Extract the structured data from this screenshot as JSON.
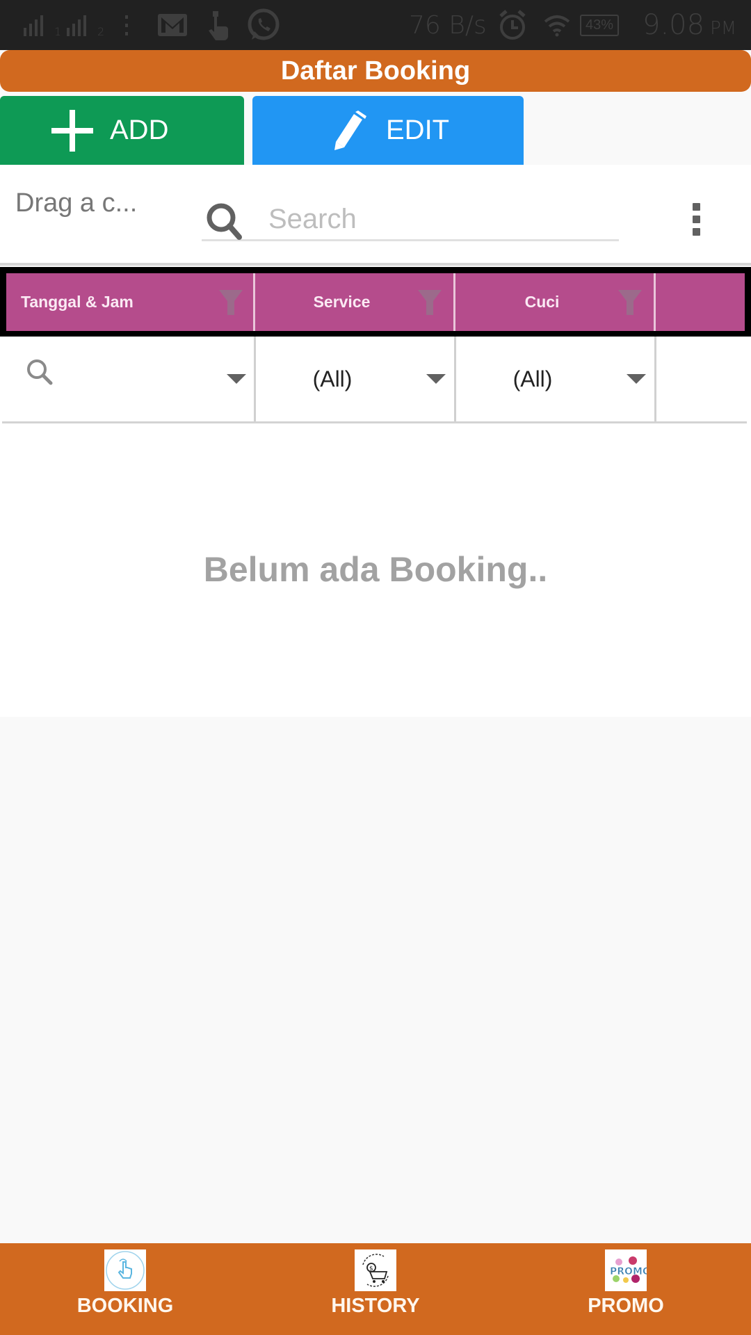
{
  "status_bar": {
    "signal1": "1",
    "signal2": "2",
    "net_speed": "76 B/s",
    "battery": "43%",
    "time": "9.08",
    "ampm": "PM"
  },
  "header": {
    "title": "Daftar Booking"
  },
  "actions": {
    "add_label": "ADD",
    "edit_label": "EDIT"
  },
  "toolbar": {
    "drag_hint": "Drag a c...",
    "search_placeholder": "Search",
    "search_value": ""
  },
  "grid": {
    "columns": [
      {
        "label": "Tanggal & Jam"
      },
      {
        "label": "Service"
      },
      {
        "label": "Cuci"
      },
      {
        "label": ""
      }
    ],
    "filters": [
      {
        "value": ""
      },
      {
        "value": "(All)"
      },
      {
        "value": "(All)"
      },
      {
        "value": ""
      }
    ],
    "empty_message": "Belum ada Booking.."
  },
  "bottom_nav": {
    "items": [
      {
        "label": "BOOKING",
        "icon": "tap-hand-icon"
      },
      {
        "label": "HISTORY",
        "icon": "cart-cycle-icon"
      },
      {
        "label": "PROMO",
        "icon": "promo-badge-icon"
      }
    ]
  },
  "colors": {
    "primary_orange": "#d1691f",
    "add_green": "#0e9a55",
    "edit_blue": "#2196f3",
    "grid_header_pink": "#b54c8c",
    "status_bar": "#212121"
  }
}
